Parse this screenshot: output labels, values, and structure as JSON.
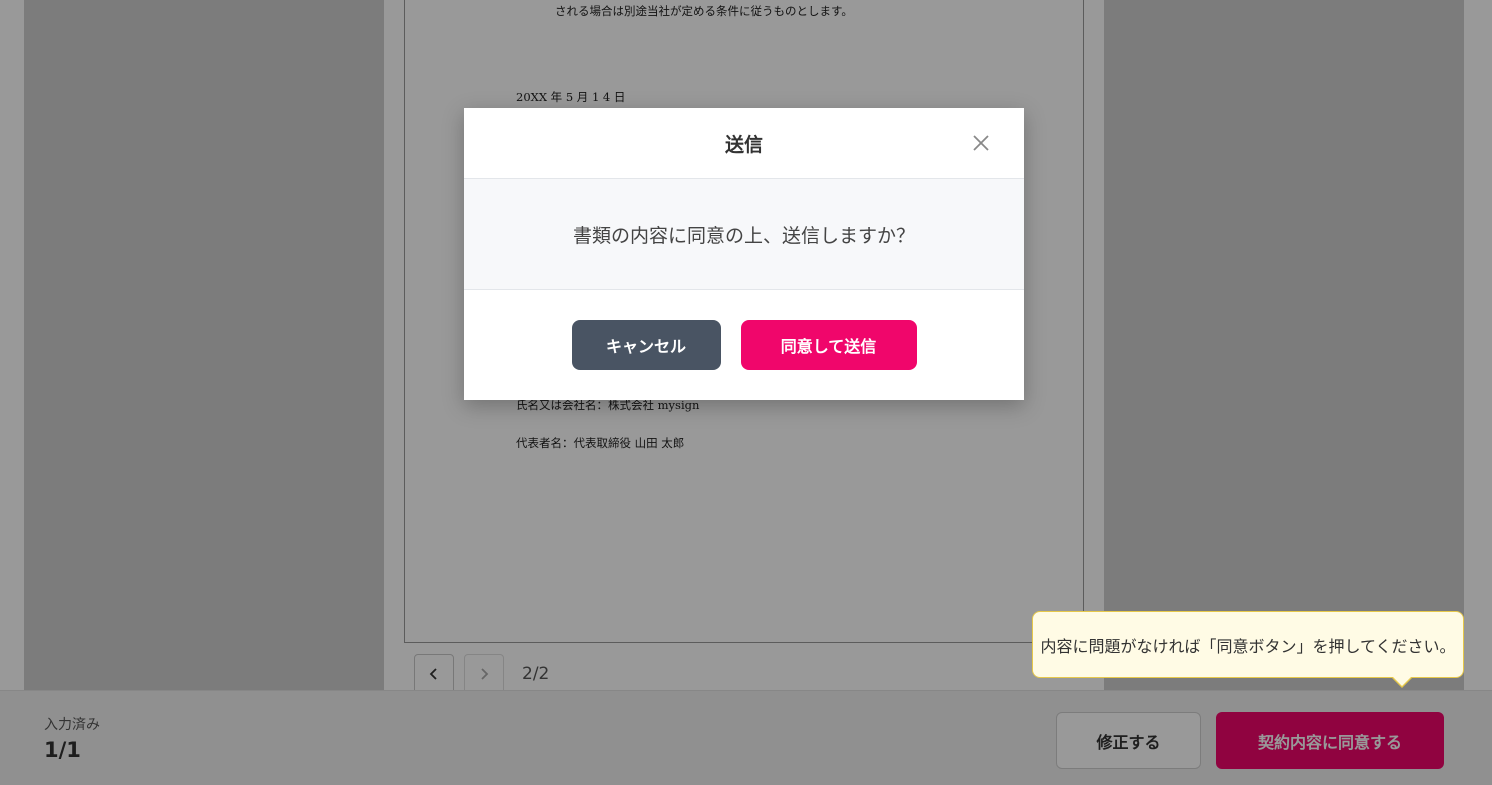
{
  "document": {
    "line_top": "される場合は別途当社が定める条件に従うものとします。",
    "date": "20XX 年 5 月 1 4 日",
    "company_name": "氏名又は会社名：株式会社 mysign",
    "representative": "代表者名：代表取締役 山田  太郎"
  },
  "pager": {
    "prev_icon": "chevron-left-icon",
    "next_icon": "chevron-right-icon",
    "page_label": "2/2"
  },
  "modal": {
    "title": "送信",
    "message": "書類の内容に同意の上、送信しますか？",
    "cancel_label": "キャンセル",
    "agree_label": "同意して送信",
    "close_icon": "close-icon"
  },
  "tooltip": {
    "text": "内容に問題がなければ「同意ボタン」を押してください。"
  },
  "bottom_bar": {
    "status_label": "入力済み",
    "status_value": "1/1",
    "fix_label": "修正する",
    "consent_label": "契約内容に同意する"
  },
  "colors": {
    "accent": "#f0066b",
    "cancel": "#495463",
    "tooltip_bg": "#fffbe5",
    "tooltip_border": "#e6c84a"
  }
}
